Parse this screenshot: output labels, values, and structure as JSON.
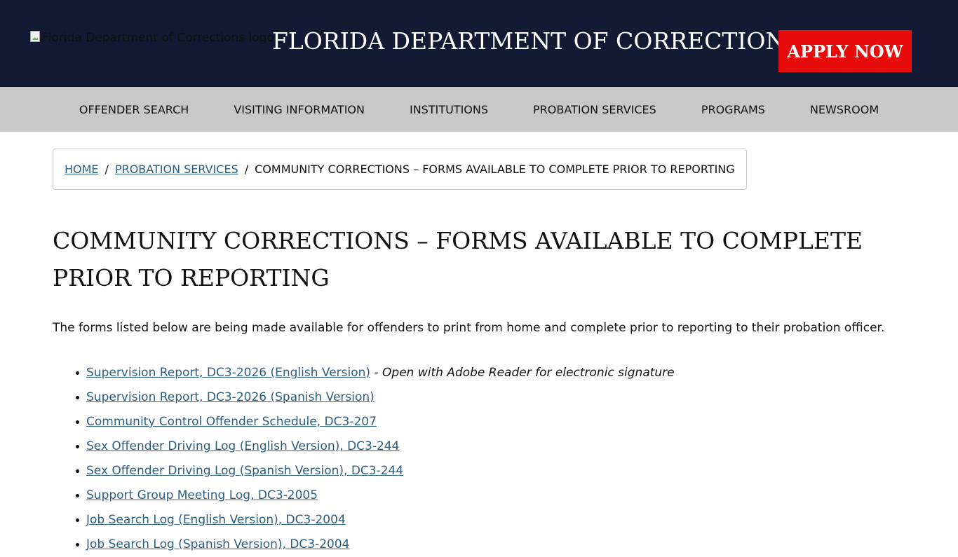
{
  "header": {
    "logo_alt": "Florida Department of Corrections logo",
    "title": "FLORIDA DEPARTMENT OF CORRECTIONS",
    "apply_label": "APPLY NOW"
  },
  "nav": {
    "items": [
      {
        "label": "OFFENDER SEARCH"
      },
      {
        "label": "VISITING INFORMATION"
      },
      {
        "label": "INSTITUTIONS"
      },
      {
        "label": "PROBATION SERVICES"
      },
      {
        "label": "PROGRAMS"
      },
      {
        "label": "NEWSROOM"
      }
    ]
  },
  "breadcrumb": {
    "home": "HOME",
    "separator": "/",
    "parent": "PROBATION SERVICES",
    "current": "COMMUNITY CORRECTIONS – FORMS AVAILABLE TO COMPLETE PRIOR TO REPORTING"
  },
  "page": {
    "title": "COMMUNITY CORRECTIONS – FORMS AVAILABLE TO COMPLETE PRIOR TO REPORTING",
    "intro": "The forms listed below are being made available for offenders to print from home and complete prior to reporting to their probation officer."
  },
  "forms": [
    {
      "label": "Supervision Report, DC3-2026 (English Version)",
      "dash": " - ",
      "note": "Open with Adobe Reader for electronic signature"
    },
    {
      "label": "Supervision Report, DC3-2026 (Spanish Version)"
    },
    {
      "label": "Community Control Offender Schedule, DC3-207"
    },
    {
      "label": "Sex Offender Driving Log (English Version), DC3-244"
    },
    {
      "label": "Sex Offender Driving Log (Spanish Version), DC3-244"
    },
    {
      "label": "Support Group Meeting Log, DC3-2005"
    },
    {
      "label": "Job Search Log (English Version), DC3-2004"
    },
    {
      "label": "Job Search Log (Spanish Version), DC3-2004"
    }
  ],
  "colors": {
    "header_bg": "#121b33",
    "nav_bg": "#c8c8c8",
    "apply_bg": "#e70d0d",
    "link": "#2b5f82"
  }
}
